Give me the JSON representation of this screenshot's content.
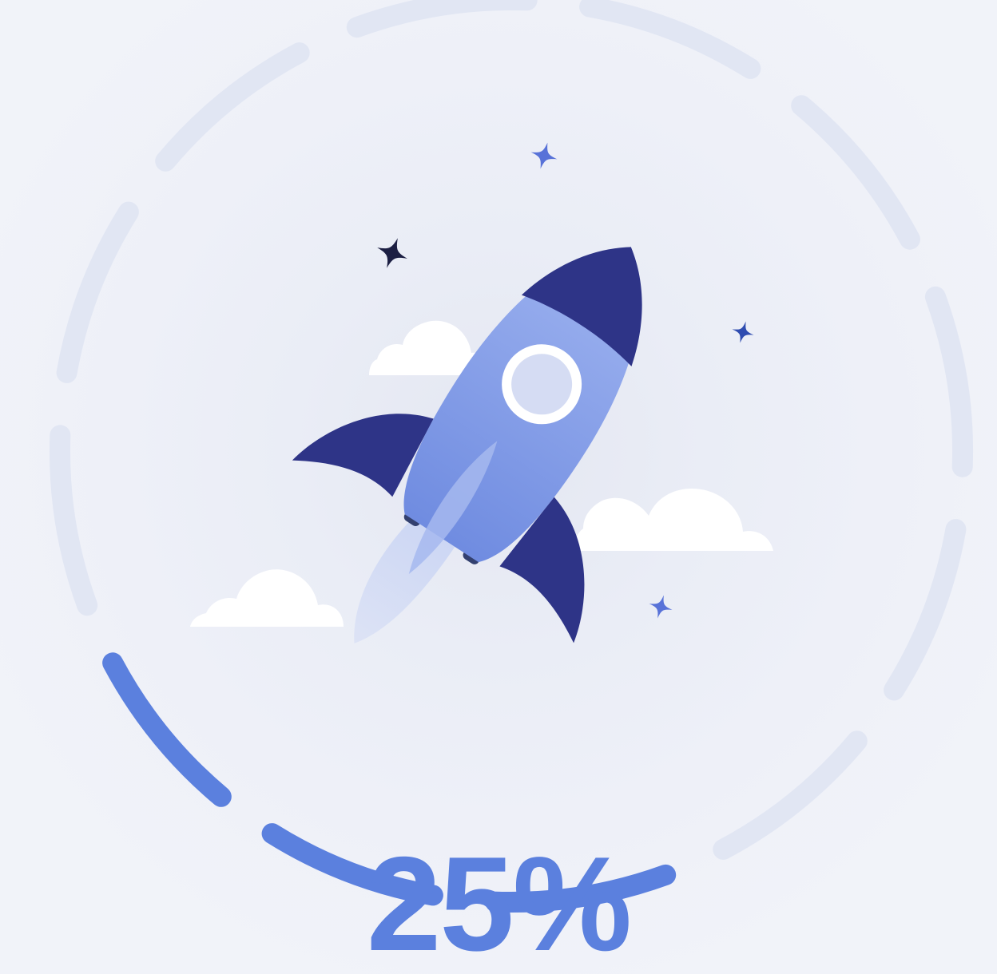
{
  "progress": {
    "percent_text": "25%",
    "value": 0.25,
    "segments_total": 12,
    "segments_filled": 3
  },
  "colors": {
    "background": "#eef0f8",
    "track": "#e1e6f3",
    "fill": "#5b80de",
    "rocket_body": "#7f9be6",
    "rocket_dark": "#2e3487",
    "window": "#d5dcf3",
    "cloud": "#ffffff",
    "star_blue": "#5872d8",
    "star_dark": "#1c1f43"
  },
  "icons": {
    "rocket": "rocket-icon",
    "cloud": "cloud-icon",
    "star": "sparkle-icon"
  }
}
